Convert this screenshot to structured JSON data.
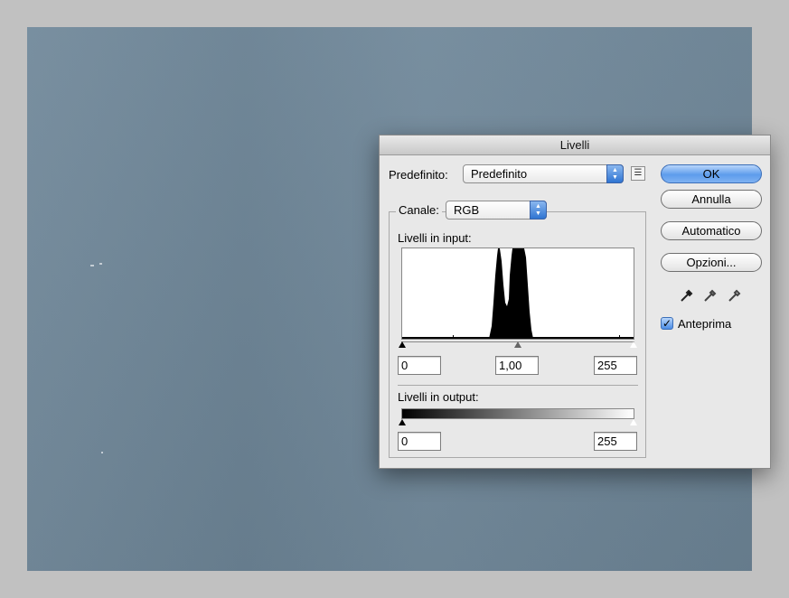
{
  "dialog": {
    "title": "Livelli",
    "preset_label": "Predefinito:",
    "preset_value": "Predefinito",
    "channel_label": "Canale:",
    "channel_value": "RGB",
    "input_levels_label": "Livelli in input:",
    "input_black": "0",
    "input_gamma": "1,00",
    "input_white": "255",
    "output_levels_label": "Livelli in output:",
    "output_black": "0",
    "output_white": "255",
    "buttons": {
      "ok": "OK",
      "cancel": "Annulla",
      "auto": "Automatico",
      "options": "Opzioni..."
    },
    "preview_label": "Anteprima",
    "preview_checked": true,
    "eyedroppers": [
      "black-eyedropper-icon",
      "gray-eyedropper-icon",
      "white-eyedropper-icon"
    ]
  },
  "colors": {
    "canvas": "#6f8799",
    "accent": "#5d9cec"
  }
}
